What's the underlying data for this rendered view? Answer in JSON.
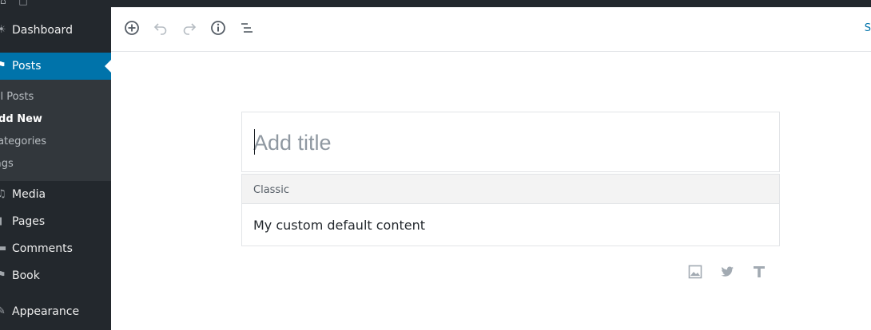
{
  "admin_bar": {
    "icons": "⌂ □"
  },
  "sidebar": {
    "items": [
      {
        "label": "Dashboard",
        "icon": "dashboard-icon",
        "glyph": "☀"
      },
      {
        "label": "Posts",
        "icon": "pin-icon",
        "glyph": "⚑"
      },
      {
        "label": "Media",
        "icon": "media-icon",
        "glyph": "♫"
      },
      {
        "label": "Pages",
        "icon": "pages-icon",
        "glyph": "▮"
      },
      {
        "label": "Comments",
        "icon": "comments-icon",
        "glyph": "▬"
      },
      {
        "label": "Book",
        "icon": "book-icon",
        "glyph": "⚑"
      },
      {
        "label": "Appearance",
        "icon": "brush-icon",
        "glyph": "✎"
      }
    ],
    "submenu": [
      {
        "label": "All Posts"
      },
      {
        "label": "Add New"
      },
      {
        "label": "Categories"
      },
      {
        "label": "Tags"
      }
    ]
  },
  "toolbar": {
    "buttons": [
      {
        "name": "add-block",
        "icon": "plus-circle-icon"
      },
      {
        "name": "undo",
        "icon": "undo-icon"
      },
      {
        "name": "redo",
        "icon": "redo-icon"
      },
      {
        "name": "content-info",
        "icon": "info-icon"
      },
      {
        "name": "block-navigation",
        "icon": "list-icon"
      }
    ],
    "save_link": "S"
  },
  "editor": {
    "title_placeholder": "Add title",
    "title_value": "",
    "classic_block": {
      "label": "Classic",
      "content": "My custom default content"
    },
    "inserters": [
      {
        "icon": "image-icon"
      },
      {
        "icon": "twitter-icon"
      },
      {
        "icon": "text-icon"
      }
    ]
  },
  "colors": {
    "sidebar_bg": "#23282d",
    "accent": "#0073aa",
    "submenu_bg": "#32373c"
  }
}
